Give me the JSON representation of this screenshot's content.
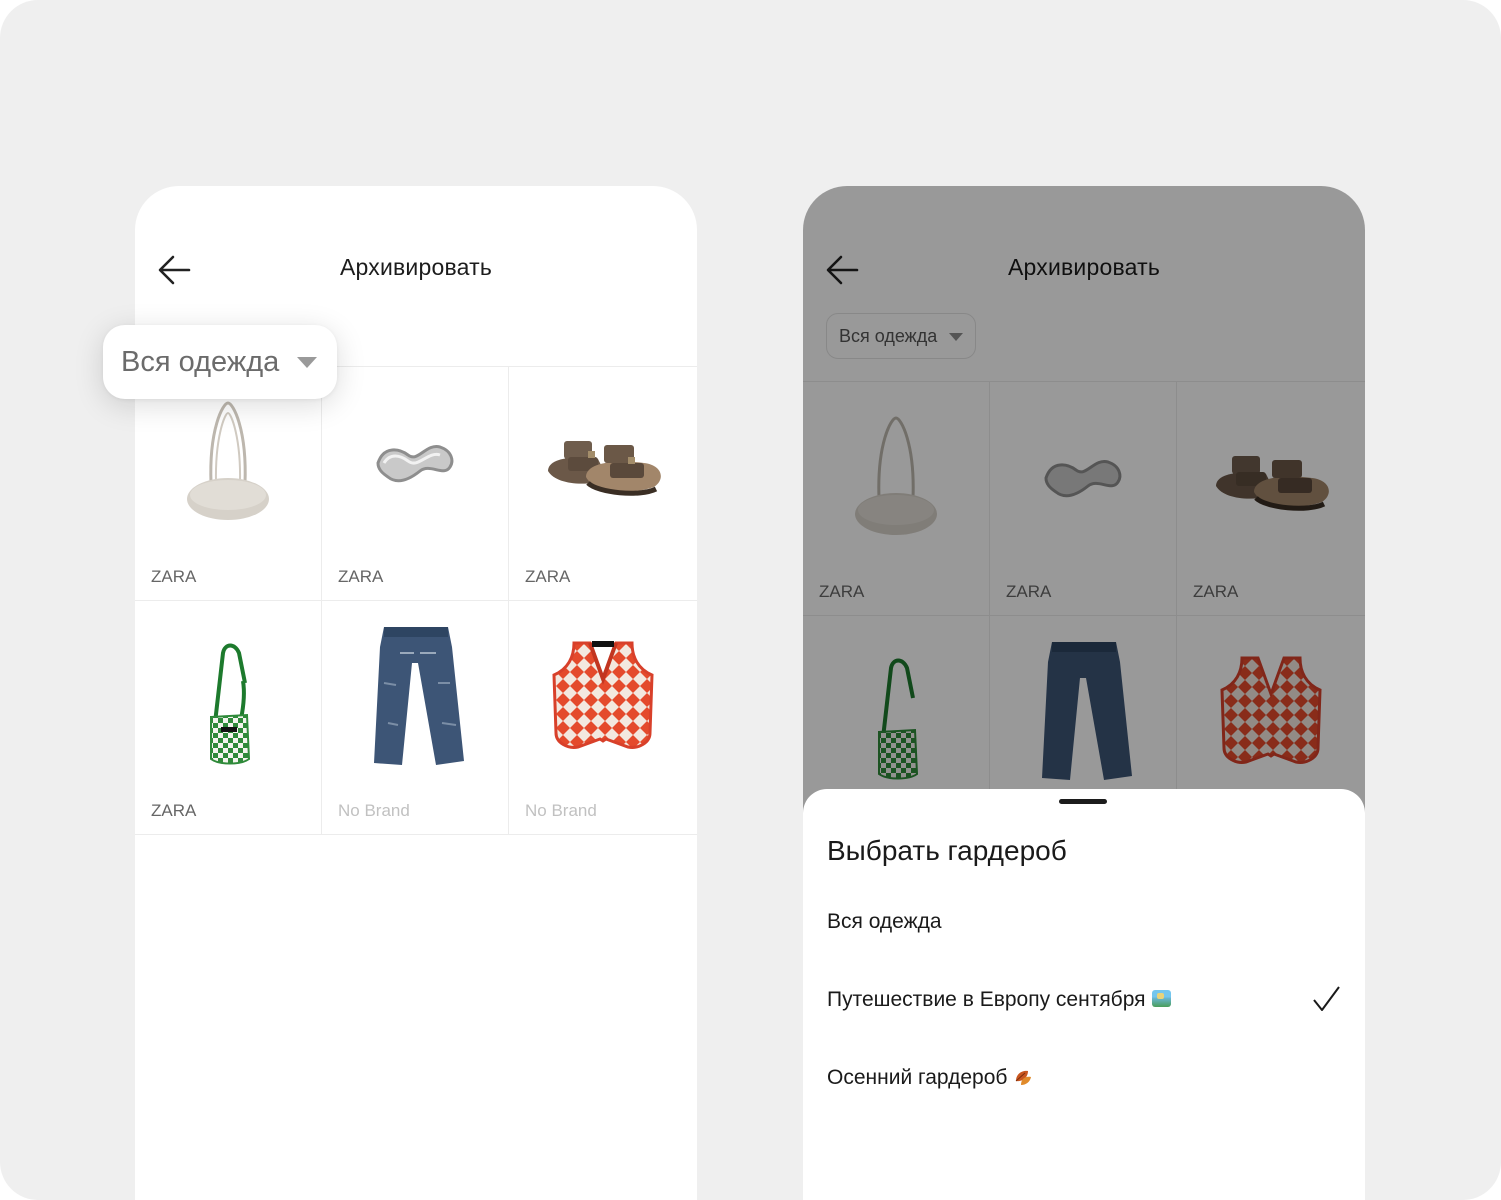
{
  "header": {
    "title": "Архивировать"
  },
  "filter": {
    "selected": "Вся одежда",
    "selected_large": "Вся одежда"
  },
  "items": [
    {
      "brand": "ZARA",
      "icon": "shoulder-bag",
      "muted": false
    },
    {
      "brand": "ZARA",
      "icon": "ring",
      "muted": false
    },
    {
      "brand": "ZARA",
      "icon": "sandals",
      "muted": false
    },
    {
      "brand": "ZARA",
      "icon": "crochet-bag",
      "muted": false
    },
    {
      "brand": "No Brand",
      "icon": "jeans",
      "muted": true
    },
    {
      "brand": "No Brand",
      "icon": "argyle-vest",
      "muted": true
    }
  ],
  "sheet": {
    "title": "Выбрать гардероб",
    "options": [
      {
        "label": "Вся одежда",
        "selected": false
      },
      {
        "label": "Путешествие в Европу сентября",
        "emoji": "map-emoji",
        "selected": true
      },
      {
        "label": "Осенний гардероб",
        "emoji": "leaves-emoji",
        "selected": false
      }
    ]
  },
  "colors": {
    "background": "#efefef",
    "overlay": "rgba(0,0,0,0.40)",
    "muted_brand": "#c1c1c1"
  }
}
